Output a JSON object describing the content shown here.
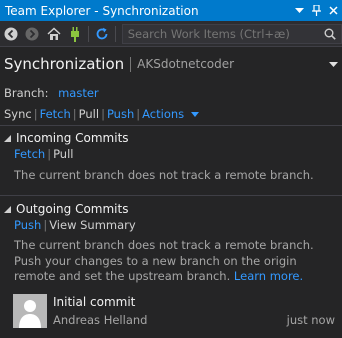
{
  "window": {
    "title": "Team Explorer - Synchronization"
  },
  "toolbar": {
    "search_placeholder": "Search Work Items (Ctrl+æ)",
    "icons": [
      "back-icon",
      "forward-icon",
      "home-icon",
      "connect-icon",
      "refresh-icon",
      "search-icon"
    ]
  },
  "header": {
    "title": "Synchronization",
    "context": "AKSdotnetcoder"
  },
  "branch": {
    "label": "Branch:",
    "name": "master"
  },
  "actions": {
    "sync": "Sync",
    "fetch": "Fetch",
    "pull": "Pull",
    "push": "Push",
    "more": "Actions"
  },
  "incoming": {
    "title": "Incoming Commits",
    "fetch": "Fetch",
    "pull": "Pull",
    "message": "The current branch does not track a remote branch."
  },
  "outgoing": {
    "title": "Outgoing Commits",
    "push": "Push",
    "view_summary": "View Summary",
    "message": "The current branch does not track a remote branch. Push your changes to a new branch on the origin remote and set the upstream branch.",
    "learn_more": "Learn more.",
    "commits": [
      {
        "message": "Initial commit",
        "author": "Andreas Helland",
        "time": "just now"
      }
    ]
  },
  "colors": {
    "accent": "#007acc",
    "link": "#3399ff",
    "background": "#252526"
  }
}
